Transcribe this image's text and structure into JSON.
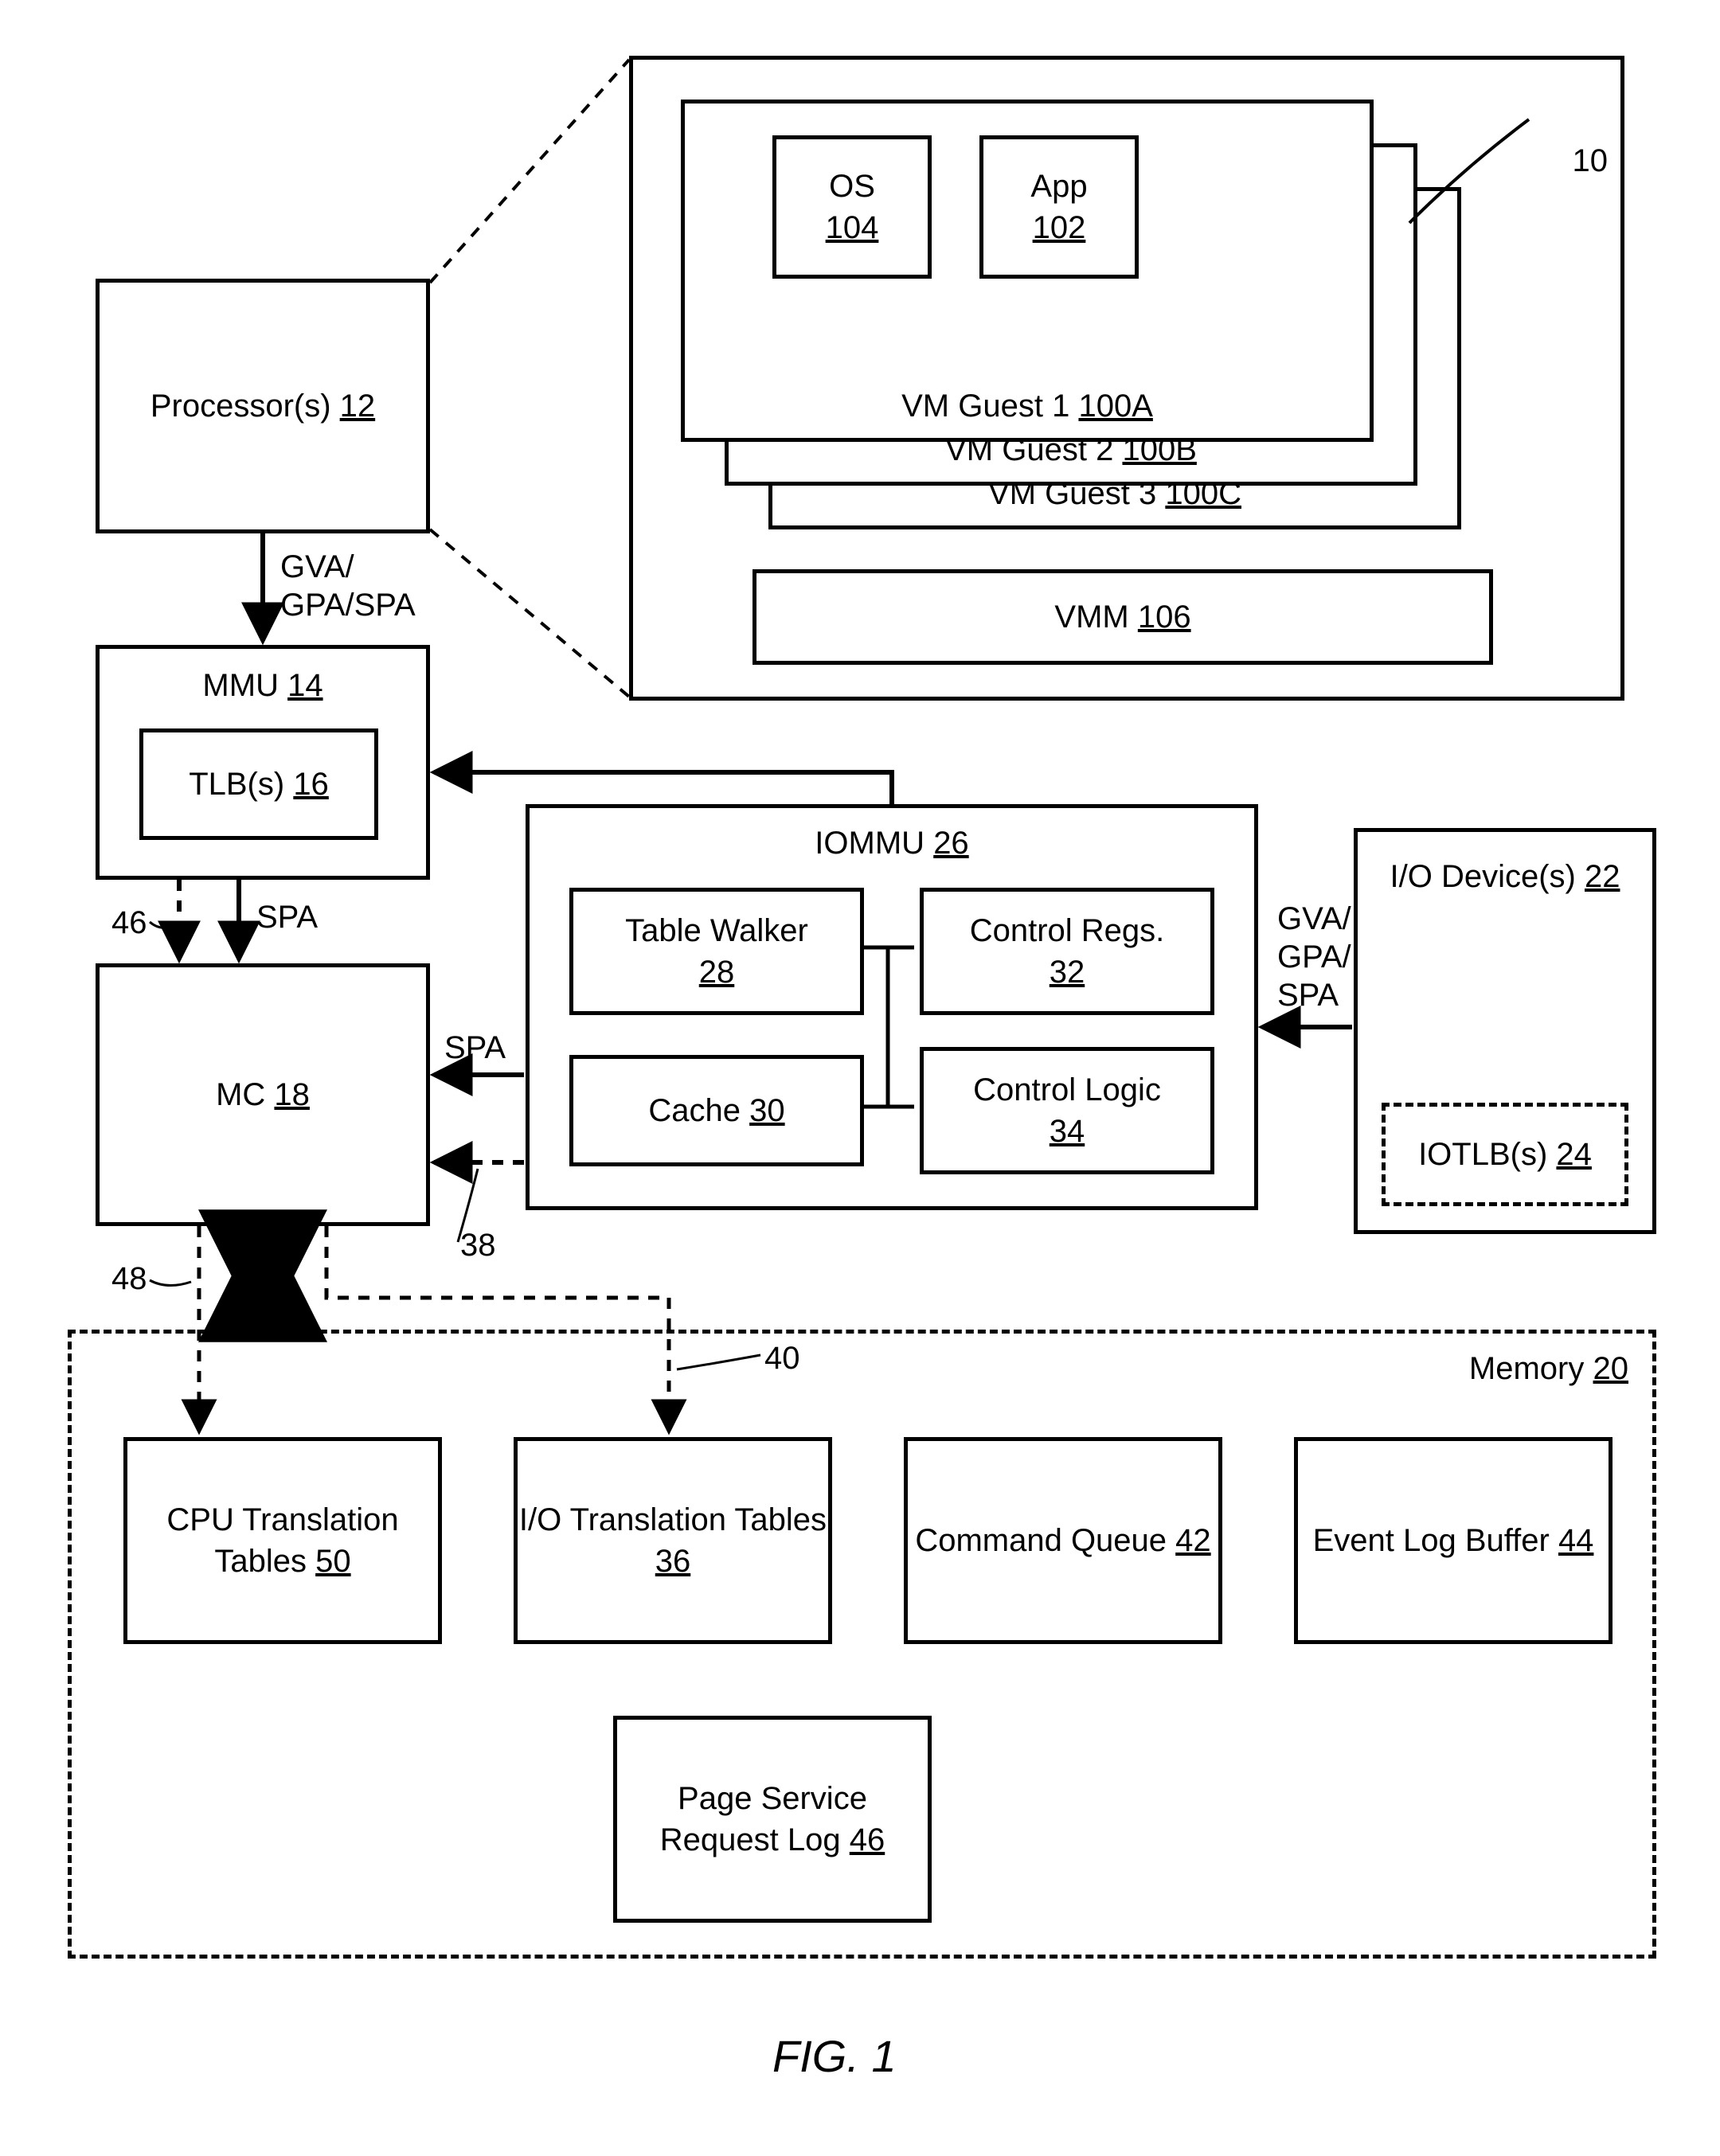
{
  "figure_ref": "10",
  "fig_caption": "FIG. 1",
  "processors": {
    "label": "Processor(s)",
    "ref": "12"
  },
  "mmu": {
    "label": "MMU",
    "ref": "14"
  },
  "tlb": {
    "label": "TLB(s)",
    "ref": "16"
  },
  "mc": {
    "label": "MC",
    "ref": "18"
  },
  "memory": {
    "label": "Memory",
    "ref": "20"
  },
  "io_devices": {
    "label": "I/O Device(s)",
    "ref": "22"
  },
  "iotlb": {
    "label": "IOTLB(s)",
    "ref": "24"
  },
  "iommu": {
    "label": "IOMMU",
    "ref": "26"
  },
  "table_walker": {
    "label": "Table Walker",
    "ref": "28"
  },
  "cache": {
    "label": "Cache",
    "ref": "30"
  },
  "control_regs": {
    "label": "Control Regs.",
    "ref": "32"
  },
  "control_logic": {
    "label": "Control Logic",
    "ref": "34"
  },
  "io_trans": {
    "label": "I/O Translation\nTables",
    "ref": "36"
  },
  "cpu_trans": {
    "label": "CPU Translation\nTables",
    "ref": "50"
  },
  "cmd_queue": {
    "label": "Command\nQueue",
    "ref": "42"
  },
  "event_log": {
    "label": "Event Log\nBuffer",
    "ref": "44"
  },
  "page_svc": {
    "label": "Page Service\nRequest Log",
    "ref": "46"
  },
  "os": {
    "label": "OS",
    "ref": "104"
  },
  "app": {
    "label": "App",
    "ref": "102"
  },
  "vm1": {
    "label": "VM Guest 1",
    "ref": "100A"
  },
  "vm2": {
    "label": "VM Guest 2",
    "ref": "100B"
  },
  "vm3": {
    "label": "VM Guest 3",
    "ref": "100C"
  },
  "vmm": {
    "label": "VMM",
    "ref": "106"
  },
  "arrows": {
    "gva_gpa_spa_top": "GVA/\nGPA/SPA",
    "gva_gpa_spa_right": "GVA/\nGPA/\nSPA",
    "spa_left": "SPA",
    "spa_mid": "SPA",
    "n46": "46",
    "n48": "48",
    "n38": "38",
    "n40": "40"
  }
}
